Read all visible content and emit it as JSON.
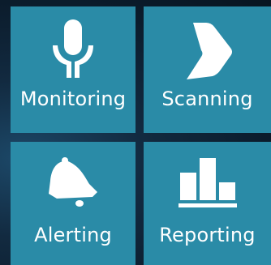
{
  "tiles": [
    {
      "label": "Monitoring",
      "icon": "microphone-hands-icon"
    },
    {
      "label": "Scanning",
      "icon": "chevron-right-icon"
    },
    {
      "label": "Alerting",
      "icon": "bell-icon"
    },
    {
      "label": "Reporting",
      "icon": "bar-chart-icon"
    }
  ],
  "colors": {
    "tile": "#2a8ba7",
    "icon": "#ffffff",
    "background": "#0b1c2c"
  }
}
